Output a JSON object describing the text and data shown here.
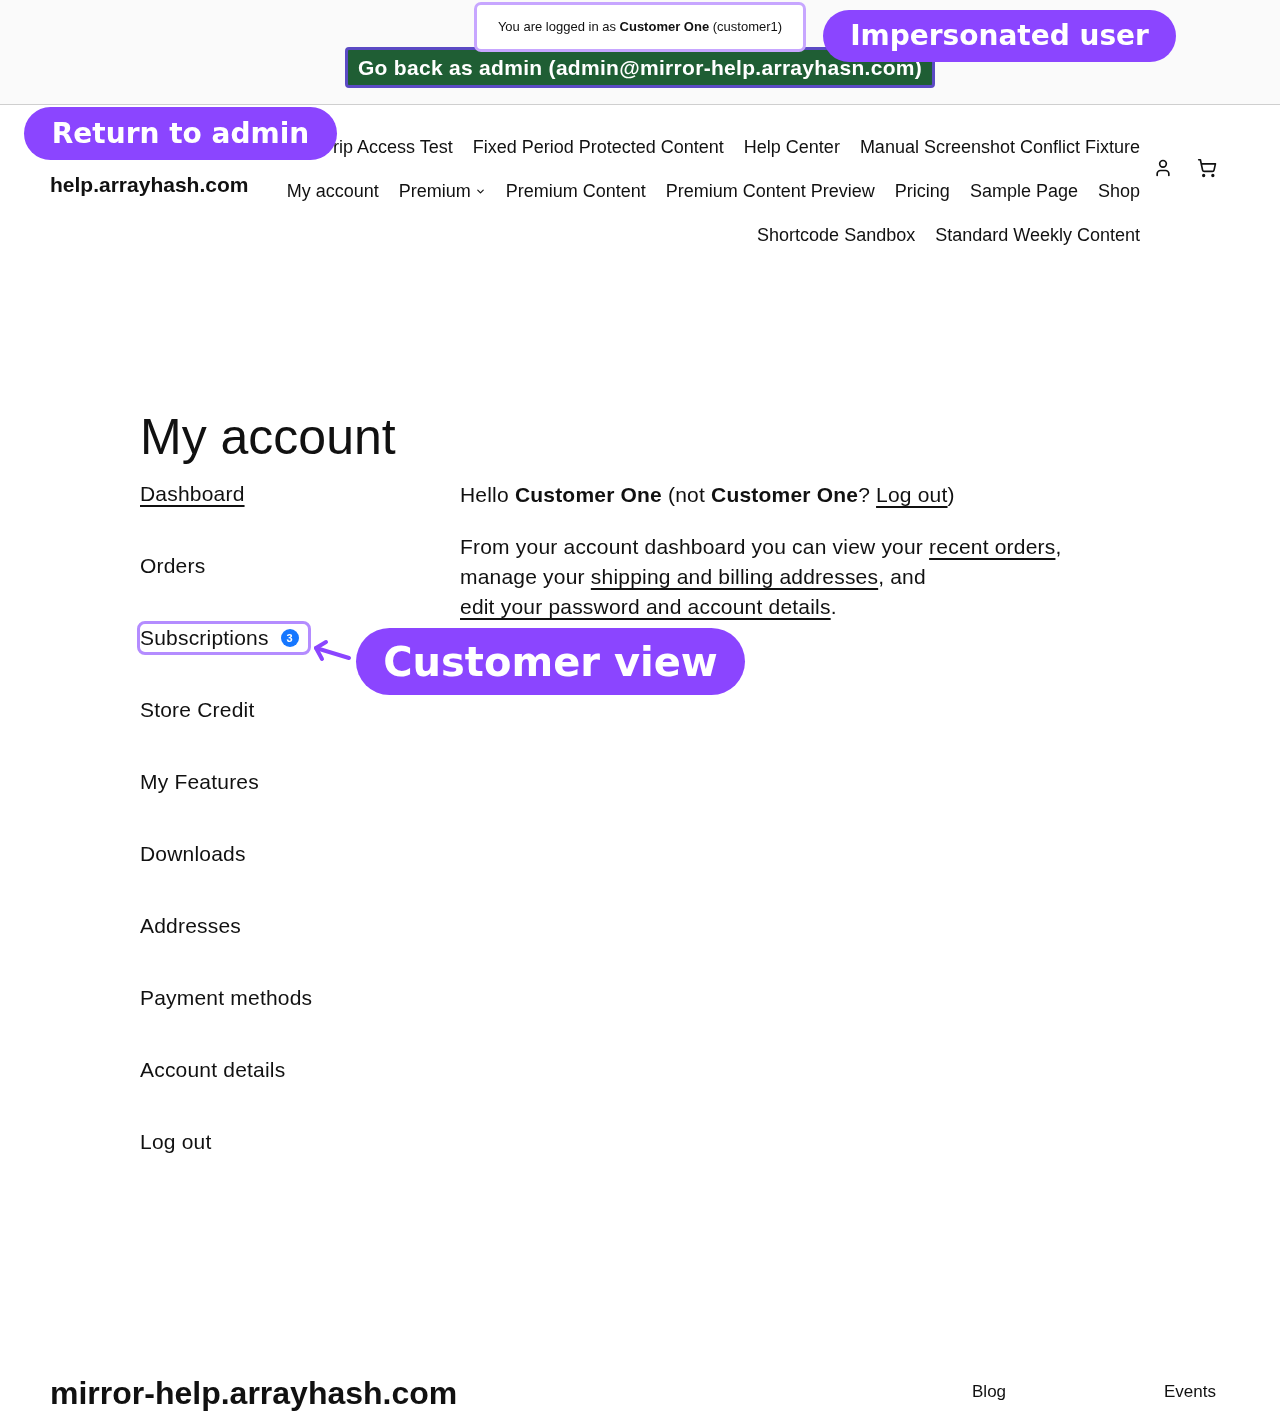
{
  "admin_bar": {
    "notice": "You are logged in as **Customer One** (customer1)",
    "switch_back_button": "Go back as admin (admin@mirror-help.arrayhasn.com)"
  },
  "annotations": {
    "admin_bar_callout": "Impersonated user",
    "header_callout": "Return to admin",
    "menu_callout": "Customer view"
  },
  "header": {
    "site_title": "help.arrayhash.com",
    "nav_rows": [
      [
        {
          "label": "rip Access Test",
          "kind": "link"
        },
        {
          "label": "Fixed Period Protected Content",
          "kind": "link"
        },
        {
          "label": "Help Center",
          "kind": "link"
        },
        {
          "label": "Manual Screenshot Conflict Fixture",
          "kind": "link"
        }
      ],
      [
        {
          "label": "My account",
          "kind": "link"
        },
        {
          "label": "Premium",
          "kind": "dropdown"
        },
        {
          "label": "Premium Content",
          "kind": "link"
        },
        {
          "label": "Premium Content Preview",
          "kind": "link"
        },
        {
          "label": "Pricing",
          "kind": "link"
        },
        {
          "label": "Sample Page",
          "kind": "link"
        },
        {
          "label": "Shop",
          "kind": "link"
        }
      ],
      [
        {
          "label": "Shortcode Sandbox",
          "kind": "link"
        },
        {
          "label": "Standard Weekly Content",
          "kind": "link"
        }
      ]
    ]
  },
  "page_title": "My account",
  "account_menu": [
    {
      "label": "Dashboard",
      "selected": true,
      "highlighted": false
    },
    {
      "label": "Orders",
      "selected": false,
      "highlighted": false
    },
    {
      "label": "Subscriptions",
      "selected": false,
      "highlighted": true,
      "badge": "3"
    },
    {
      "label": "Store Credit",
      "selected": false,
      "highlighted": false
    },
    {
      "label": "My Features",
      "selected": false,
      "highlighted": false
    },
    {
      "label": "Downloads",
      "selected": false,
      "highlighted": false
    },
    {
      "label": "Addresses",
      "selected": false,
      "highlighted": false
    },
    {
      "label": "Payment methods",
      "selected": false,
      "highlighted": false
    },
    {
      "label": "Account details",
      "selected": false,
      "highlighted": false
    },
    {
      "label": "Log out",
      "selected": false,
      "highlighted": false
    }
  ],
  "dashboard": {
    "greeting": [
      {
        "kind": "text",
        "text": "Hello **Customer One** (not **Customer One**? "
      },
      {
        "kind": "link",
        "text": "Log out"
      },
      {
        "kind": "text",
        "text": ")"
      }
    ],
    "intro": [
      {
        "kind": "text",
        "text": "From your account dashboard you can view your "
      },
      {
        "kind": "link",
        "text": "recent orders"
      },
      {
        "kind": "text",
        "text": ", manage your "
      },
      {
        "kind": "link",
        "text": "shipping and billing addresses"
      },
      {
        "kind": "text",
        "text": ", and "
      },
      {
        "kind": "link",
        "text": "edit your password and account details"
      },
      {
        "kind": "text",
        "text": "."
      }
    ]
  },
  "footer": {
    "site_title": "mirror-help.arrayhash.com",
    "links": [
      "Blog",
      "Events"
    ]
  }
}
